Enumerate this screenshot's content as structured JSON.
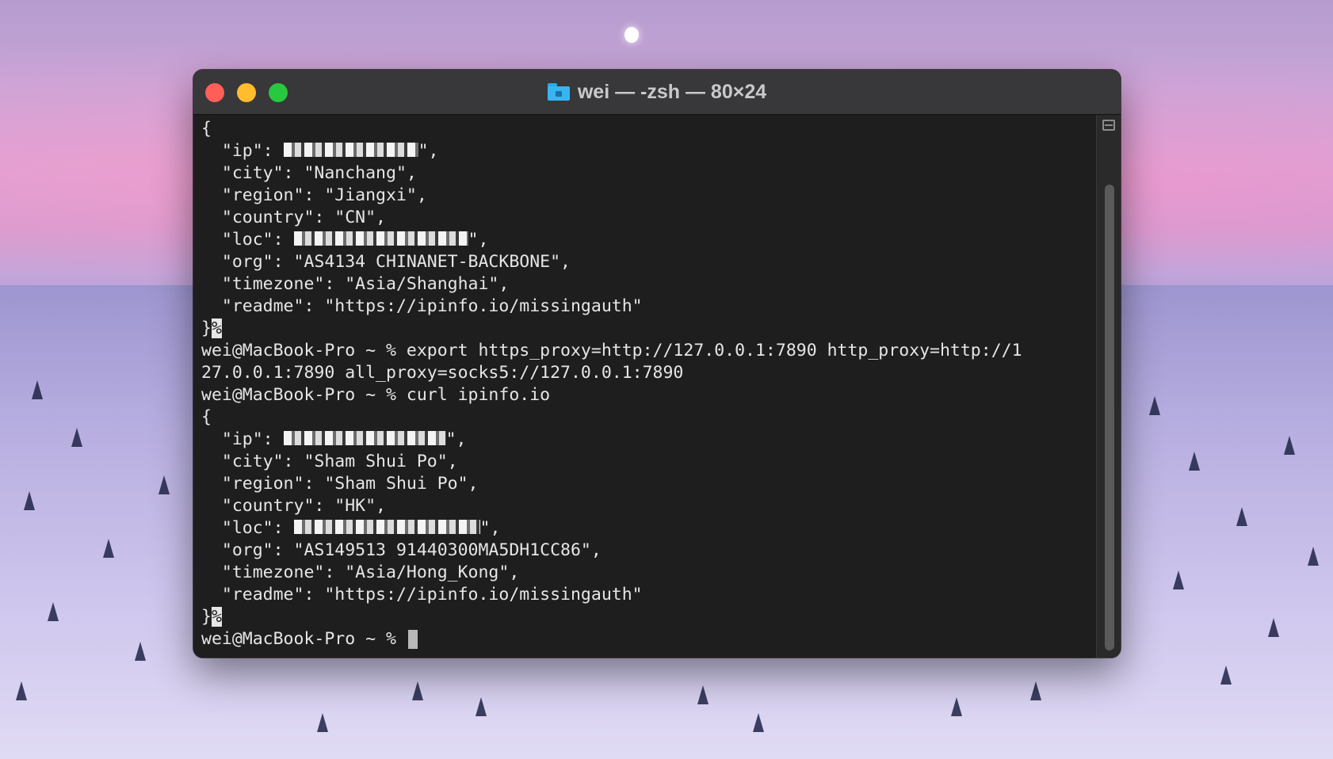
{
  "window": {
    "title": "wei — -zsh — 80×24",
    "folder_icon": "folder-home-icon"
  },
  "terminal": {
    "lines": [
      "{",
      "  \"ip\": ",
      "  \"city\": \"Nanchang\",",
      "  \"region\": \"Jiangxi\",",
      "  \"country\": \"CN\",",
      "  \"loc\": ",
      "  \"org\": \"AS4134 CHINANET-BACKBONE\",",
      "  \"timezone\": \"Asia/Shanghai\",",
      "  \"readme\": \"https://ipinfo.io/missingauth\"",
      "}",
      "wei@MacBook-Pro ~ % export https_proxy=http://127.0.0.1:7890 http_proxy=http://1",
      "27.0.0.1:7890 all_proxy=socks5://127.0.0.1:7890",
      "wei@MacBook-Pro ~ % curl ipinfo.io",
      "{",
      "  \"ip\": ",
      "  \"city\": \"Sham Shui Po\",",
      "  \"region\": \"Sham Shui Po\",",
      "  \"country\": \"HK\",",
      "  \"loc\": ",
      "  \"org\": \"AS149513 91440300MA5DH1CC86\",",
      "  \"timezone\": \"Asia/Hong_Kong\",",
      "  \"readme\": \"https://ipinfo.io/missingauth\"",
      "}",
      "wei@MacBook-Pro ~ % "
    ],
    "percent_marker": "%",
    "redacted_suffix_ip": "\",",
    "redacted_suffix_loc": "\","
  }
}
